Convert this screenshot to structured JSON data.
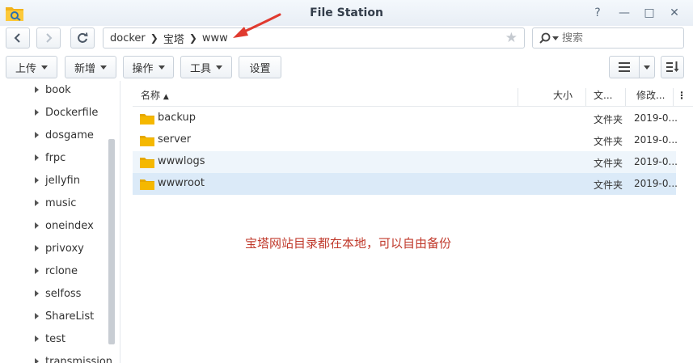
{
  "window": {
    "title": "File Station"
  },
  "nav": {
    "breadcrumb": [
      "docker",
      "宝塔",
      "www"
    ],
    "search_placeholder": "搜索"
  },
  "toolbar": {
    "upload": "上传",
    "create": "新增",
    "action": "操作",
    "tools": "工具",
    "settings": "设置"
  },
  "tree": {
    "items": [
      "book",
      "Dockerfile",
      "dosgame",
      "frpc",
      "jellyfin",
      "music",
      "oneindex",
      "privoxy",
      "rclone",
      "selfoss",
      "ShareList",
      "test",
      "transmission"
    ]
  },
  "list": {
    "headers": {
      "name": "名称",
      "size": "大小",
      "type": "文...",
      "modified": "修改..."
    },
    "rows": [
      {
        "name": "backup",
        "type": "文件夹",
        "modified": "2019-0..."
      },
      {
        "name": "server",
        "type": "文件夹",
        "modified": "2019-0..."
      },
      {
        "name": "wwwlogs",
        "type": "文件夹",
        "modified": "2019-0..."
      },
      {
        "name": "wwwroot",
        "type": "文件夹",
        "modified": "2019-0..."
      }
    ]
  },
  "annotation": "宝塔网站目录都在本地，可以自由备份",
  "colors": {
    "accent": "#2f7fcf",
    "folder": "#f5b800",
    "annotation": "#c0392b",
    "arrow": "#e03a2f"
  }
}
